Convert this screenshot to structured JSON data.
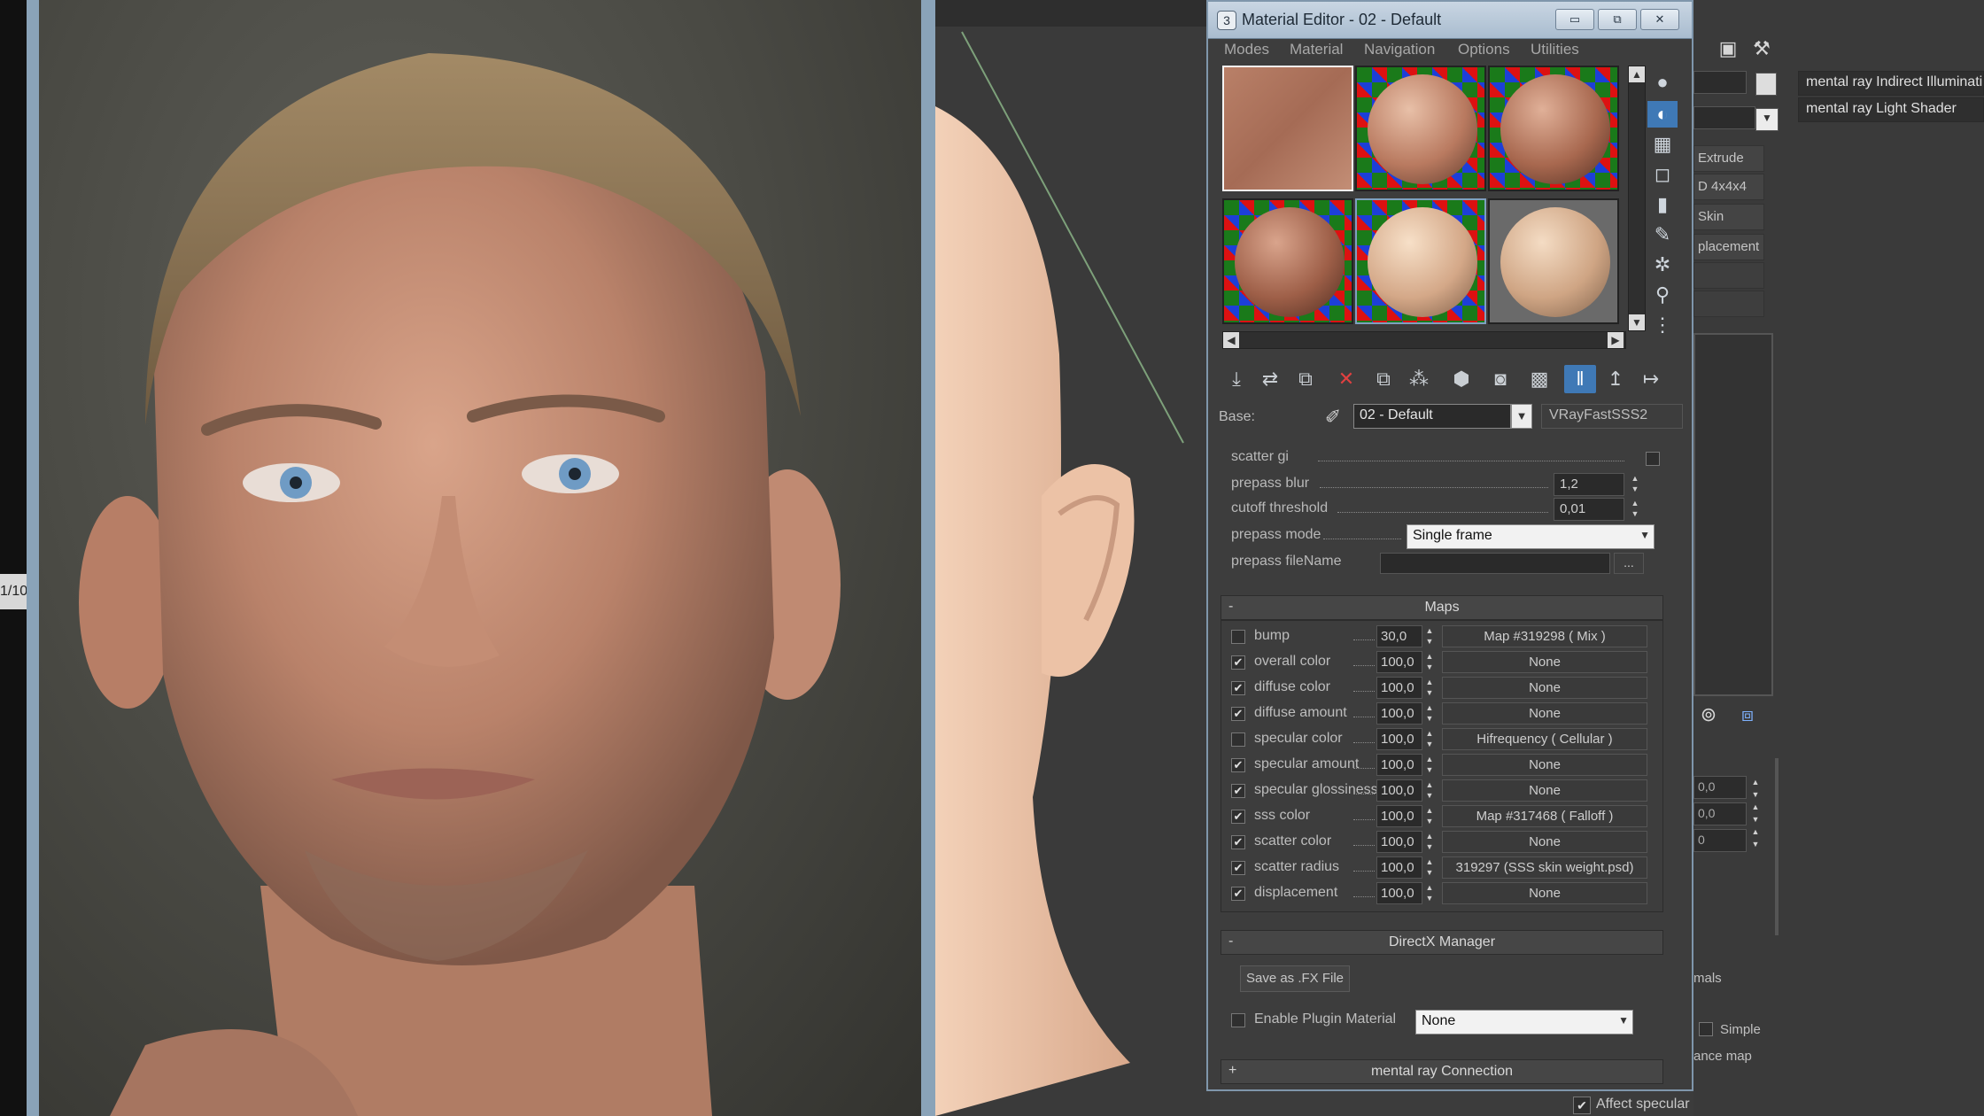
{
  "render": {
    "strip_caption": "1/10"
  },
  "material_editor": {
    "title": "Material Editor - 02 - Default",
    "app_icon": "3",
    "window_buttons": {
      "minimize": "▭",
      "restore": "⧉",
      "close": "✕"
    },
    "menu": [
      "Modes",
      "Material",
      "Navigation",
      "Options",
      "Utilities"
    ],
    "base_label": "Base:",
    "material_name": "02 - Default",
    "material_type": "VRayFastSSS2",
    "params": {
      "scatter_gi": "scatter gi",
      "prepass_blur_label": "prepass blur",
      "prepass_blur_value": "1,2",
      "cutoff_label": "cutoff threshold",
      "cutoff_value": "0,01",
      "prepass_mode_label": "prepass mode",
      "prepass_mode_value": "Single frame",
      "prepass_filename_label": "prepass fileName",
      "browse": "..."
    },
    "maps_title": "Maps",
    "maps": [
      {
        "label": "bump",
        "checked": false,
        "amount": "30,0",
        "map": "Map #319298  ( Mix )"
      },
      {
        "label": "overall color",
        "checked": true,
        "amount": "100,0",
        "map": "None"
      },
      {
        "label": "diffuse color",
        "checked": true,
        "amount": "100,0",
        "map": "None"
      },
      {
        "label": "diffuse amount",
        "checked": true,
        "amount": "100,0",
        "map": "None"
      },
      {
        "label": "specular color",
        "checked": false,
        "amount": "100,0",
        "map": "Hifrequency  ( Cellular )"
      },
      {
        "label": "specular amount",
        "checked": true,
        "amount": "100,0",
        "map": "None"
      },
      {
        "label": "specular glossiness",
        "checked": true,
        "amount": "100,0",
        "map": "None"
      },
      {
        "label": "sss color",
        "checked": true,
        "amount": "100,0",
        "map": "Map #317468  ( Falloff )"
      },
      {
        "label": "scatter color",
        "checked": true,
        "amount": "100,0",
        "map": "None"
      },
      {
        "label": "scatter radius",
        "checked": true,
        "amount": "100,0",
        "map": "319297 (SSS skin weight.psd)"
      },
      {
        "label": "displacement",
        "checked": true,
        "amount": "100,0",
        "map": "None"
      }
    ],
    "directx_title": "DirectX Manager",
    "save_fx_label": "Save as .FX File",
    "enable_plugin_label": "Enable Plugin Material",
    "plugin_value": "None",
    "mentalray_title": "mental ray Connection",
    "rollout_minus": "-",
    "rollout_plus": "+"
  },
  "command_panel": {
    "shaders": [
      "mental ray Indirect Illuminati",
      "mental ray Light Shader"
    ],
    "modifiers": [
      "Extrude",
      "D 4x4x4",
      "Skin",
      "placement"
    ],
    "spinner_values": [
      "0,0",
      "0,0",
      "0"
    ],
    "labels": {
      "mals": "mals",
      "simple": "Simple",
      "ance_map": "ance map",
      "affect_specular": "Affect specular"
    }
  }
}
